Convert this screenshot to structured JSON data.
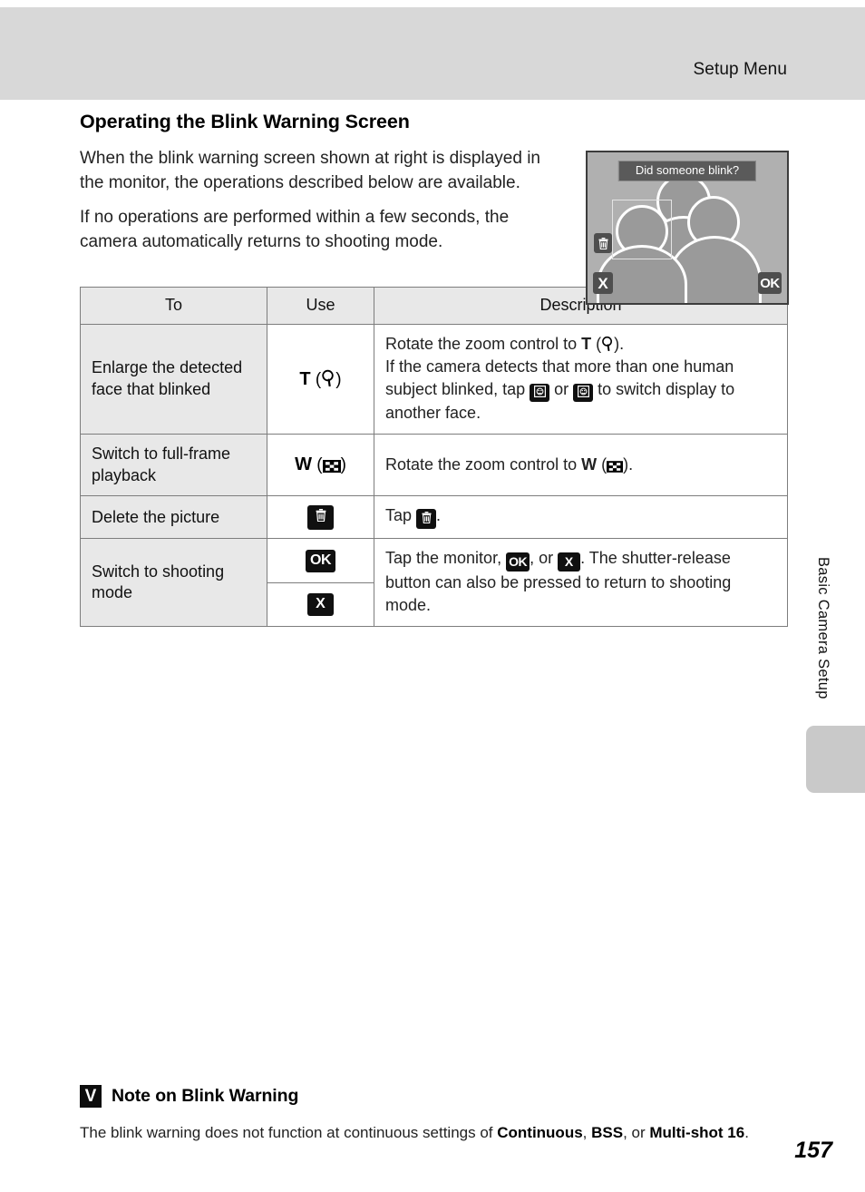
{
  "header": {
    "title": "Setup Menu"
  },
  "side": {
    "chapter": "Basic Camera Setup"
  },
  "page": {
    "number": "157"
  },
  "section": {
    "title": "Operating the Blink Warning Screen",
    "paragraph_1": "When the blink warning screen shown at right is displayed in the monitor, the operations described below are available.",
    "paragraph_2": "If no operations are performed within a few seconds, the camera automatically returns to shooting mode."
  },
  "monitor": {
    "banner": "Did someone blink?",
    "delete_icon": "trash-icon",
    "cancel_icon": "x-icon",
    "confirm_icon": "ok-icon"
  },
  "table": {
    "headers": [
      "To",
      "Use",
      "Description"
    ],
    "rows": [
      {
        "to": "Enlarge the detected face that blinked",
        "use_key": "T",
        "use_icon": "magnifier-icon",
        "desc_line_1_pre": "Rotate the zoom control to ",
        "desc_line_1_key": "T",
        "desc_line_1_post": ").",
        "desc_line_2": "If the camera detects that more than one human subject blinked, tap ",
        "desc_line_2_mid": " or ",
        "desc_line_2_post": " to switch display to another face.",
        "face_prev_icon": "face-previous-icon",
        "face_next_icon": "face-next-icon"
      },
      {
        "to": "Switch to full-frame playback",
        "use_key": "W",
        "use_icon": "thumbnail-checkerboard-icon",
        "desc_pre": "Rotate the zoom control to ",
        "desc_key": "W",
        "desc_post": ")."
      },
      {
        "to": "Delete the picture",
        "use_icon": "trash-icon",
        "desc_pre": "Tap ",
        "desc_post": "."
      },
      {
        "to": "Switch to shooting mode",
        "use_icon_1": "ok-icon",
        "use_icon_2": "x-icon",
        "use_label_1": "OK",
        "use_label_2": "X",
        "desc_pre": "Tap the monitor, ",
        "desc_mid": ", or ",
        "desc_post": ". The shutter-release button can also be pressed to return to shooting mode."
      }
    ]
  },
  "note": {
    "mark": "V",
    "title": "Note on Blink Warning",
    "body_pre": "The blink warning does not function at continuous settings of ",
    "bold_1": "Continuous",
    "sep_1": ", ",
    "bold_2": "BSS",
    "sep_2": ", or ",
    "bold_3": "Multi-shot 16",
    "body_post": "."
  },
  "colors": {
    "header_band": "#d8d8d8",
    "table_header": "#e8e8e8",
    "monitor_bg": "#b0b0b0",
    "badge": "#101010"
  }
}
